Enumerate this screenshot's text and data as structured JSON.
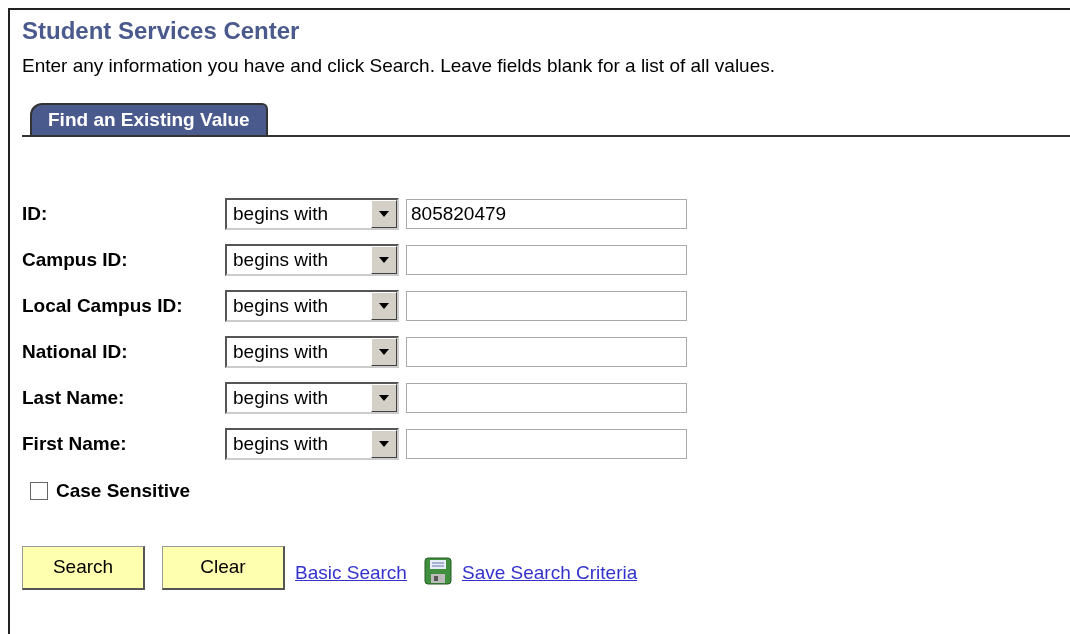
{
  "title": "Student Services Center",
  "instructions": "Enter any information you have and click Search. Leave fields blank for a list of all values.",
  "tabs": [
    {
      "label": "Find an Existing Value",
      "selected": true
    }
  ],
  "fields": [
    {
      "label": "ID:",
      "operator": "begins with",
      "value": "805820479"
    },
    {
      "label": "Campus ID:",
      "operator": "begins with"
    },
    {
      "label": "Local Campus ID:",
      "operator": "begins with"
    },
    {
      "label": "National ID:",
      "operator": "begins with"
    },
    {
      "label": "Last Name:",
      "operator": "begins with"
    },
    {
      "label": "First Name:",
      "operator": "begins with"
    }
  ],
  "case_sensitive": {
    "label": "Case Sensitive",
    "checked": false
  },
  "buttons": [
    "Search",
    "Clear"
  ],
  "links": [
    {
      "label": "Basic Search",
      "icon": false
    },
    {
      "label": "Save Search Criteria",
      "icon": true
    }
  ]
}
